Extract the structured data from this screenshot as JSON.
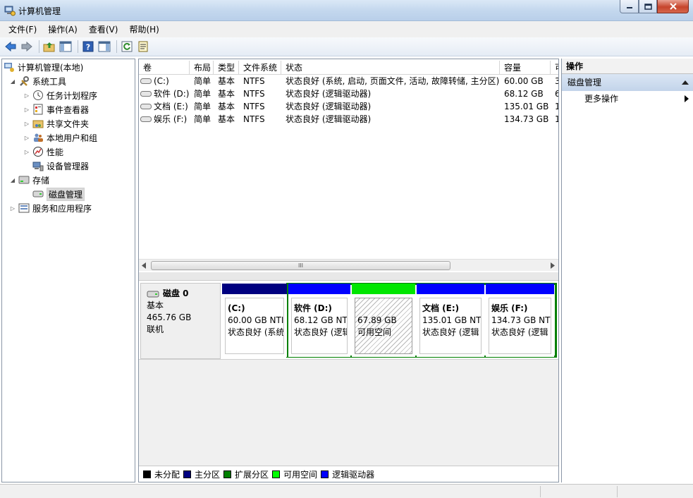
{
  "window": {
    "title": "计算机管理"
  },
  "menu": [
    "文件(F)",
    "操作(A)",
    "查看(V)",
    "帮助(H)"
  ],
  "tree": [
    {
      "label": "计算机管理(本地)",
      "level": 0,
      "expander": "",
      "icon": "computer-management-icon"
    },
    {
      "label": "系统工具",
      "level": 1,
      "expander": "◢",
      "icon": "system-tools-icon"
    },
    {
      "label": "任务计划程序",
      "level": 2,
      "expander": "▷",
      "icon": "clock-icon"
    },
    {
      "label": "事件查看器",
      "level": 2,
      "expander": "▷",
      "icon": "event-viewer-icon"
    },
    {
      "label": "共享文件夹",
      "level": 2,
      "expander": "▷",
      "icon": "shared-folder-icon"
    },
    {
      "label": "本地用户和组",
      "level": 2,
      "expander": "▷",
      "icon": "users-icon"
    },
    {
      "label": "性能",
      "level": 2,
      "expander": "▷",
      "icon": "performance-icon"
    },
    {
      "label": "设备管理器",
      "level": 2,
      "expander": "",
      "icon": "device-manager-icon"
    },
    {
      "label": "存储",
      "level": 1,
      "expander": "◢",
      "icon": "storage-icon"
    },
    {
      "label": "磁盘管理",
      "level": 2,
      "expander": "",
      "icon": "disk-management-icon",
      "selected": true
    },
    {
      "label": "服务和应用程序",
      "level": 1,
      "expander": "▷",
      "icon": "services-icon"
    }
  ],
  "volume_table": {
    "columns": [
      "卷",
      "布局",
      "类型",
      "文件系统",
      "状态",
      "容量",
      "可"
    ],
    "rows": [
      [
        "(C:)",
        "简单",
        "基本",
        "NTFS",
        "状态良好 (系统, 启动, 页面文件, 活动, 故障转储, 主分区)",
        "60.00 GB",
        "3"
      ],
      [
        "软件 (D:)",
        "简单",
        "基本",
        "NTFS",
        "状态良好 (逻辑驱动器)",
        "68.12 GB",
        "6"
      ],
      [
        "文档 (E:)",
        "简单",
        "基本",
        "NTFS",
        "状态良好 (逻辑驱动器)",
        "135.01 GB",
        "1"
      ],
      [
        "娱乐 (F:)",
        "简单",
        "基本",
        "NTFS",
        "状态良好 (逻辑驱动器)",
        "134.73 GB",
        "1"
      ]
    ]
  },
  "scroll_thumb": "III",
  "disk": {
    "name": "磁盘 0",
    "type": "基本",
    "size": "465.76 GB",
    "status": "联机",
    "partitions": [
      {
        "title": "(C:)",
        "size": "60.00 GB NTI",
        "status": "状态良好 (系统",
        "kind": "primary"
      },
      {
        "title": "软件   (D:)",
        "size": "68.12 GB NTI",
        "status": "状态良好 (逻辑",
        "kind": "logical"
      },
      {
        "title": "",
        "size": "67.89 GB",
        "status": "可用空间",
        "kind": "free"
      },
      {
        "title": "文档   (E:)",
        "size": "135.01 GB NTI",
        "status": "状态良好 (逻辑",
        "kind": "logical"
      },
      {
        "title": "娱乐   (F:)",
        "size": "134.73 GB NTI",
        "status": "状态良好 (逻辑",
        "kind": "logical"
      }
    ]
  },
  "legend": [
    {
      "label": "未分配",
      "color": "#000000"
    },
    {
      "label": "主分区",
      "color": "#000080"
    },
    {
      "label": "扩展分区",
      "color": "#008000"
    },
    {
      "label": "可用空间",
      "color": "#00ff00"
    },
    {
      "label": "逻辑驱动器",
      "color": "#0000ff"
    }
  ],
  "actions": {
    "header": "操作",
    "section": "磁盘管理",
    "more": "更多操作"
  },
  "colors": {
    "primary": "#000080",
    "logical": "#0000ff",
    "free": "#00e600",
    "extended": "#008000"
  }
}
